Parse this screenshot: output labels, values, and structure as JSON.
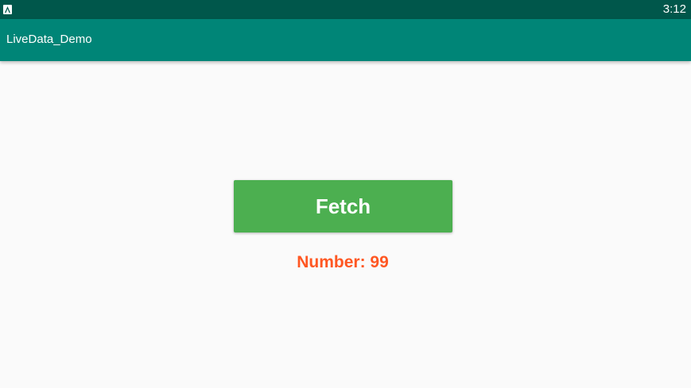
{
  "status_bar": {
    "time": "3:12",
    "app_icon": "android-app-icon"
  },
  "app_bar": {
    "title": "LiveData_Demo"
  },
  "main": {
    "fetch_button_label": "Fetch",
    "number_text": "Number: 99"
  },
  "colors": {
    "status_bar": "#00574b",
    "app_bar": "#008577",
    "button": "#4caf50",
    "number_text": "#ff5722",
    "background": "#fafafa"
  }
}
